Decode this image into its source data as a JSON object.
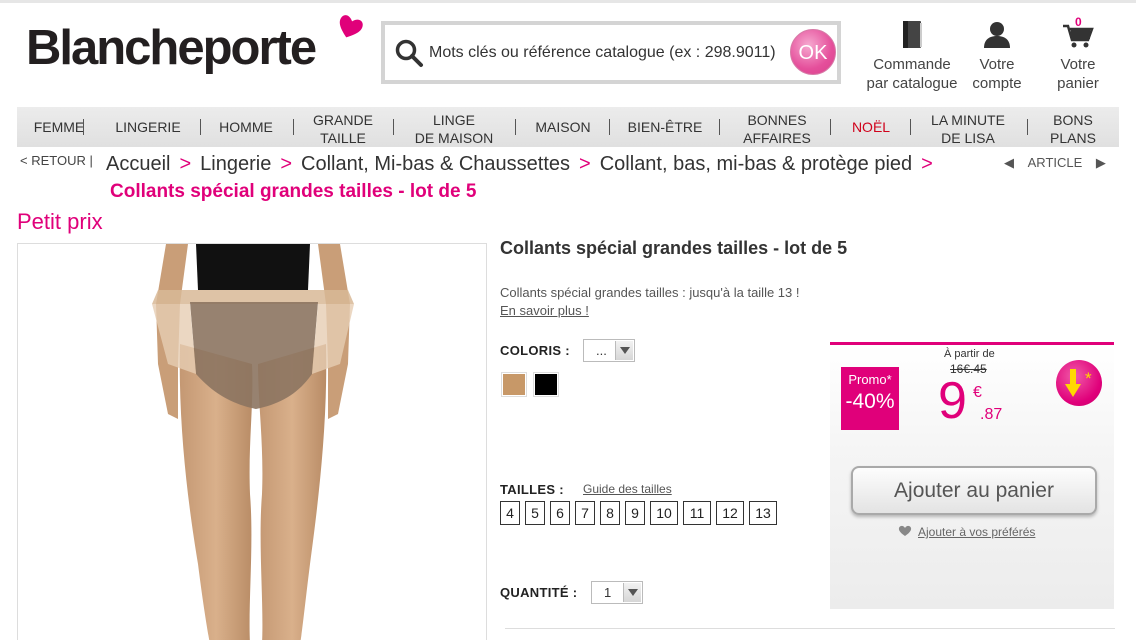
{
  "brand": {
    "logo_text": "Blancheporte"
  },
  "search": {
    "placeholder": "Mots clés ou référence catalogue (ex : 298.9011)",
    "button": "OK"
  },
  "header_links": {
    "catalogue": [
      "Commande",
      "par catalogue"
    ],
    "account": [
      "Votre",
      "compte"
    ],
    "cart": [
      "Votre",
      "panier"
    ],
    "cart_count": "0"
  },
  "nav": [
    [
      "FEMME"
    ],
    [
      "LINGERIE"
    ],
    [
      "HOMME"
    ],
    [
      "GRANDE",
      "TAILLE"
    ],
    [
      "LINGE",
      "DE MAISON"
    ],
    [
      "MAISON"
    ],
    [
      "BIEN-ÊTRE"
    ],
    [
      "BONNES",
      "AFFAIRES"
    ],
    [
      "NOËL"
    ],
    [
      "LA MINUTE",
      "DE LISA"
    ],
    [
      "BONS",
      "PLANS"
    ]
  ],
  "breadcrumb": {
    "back": "< RETOUR |",
    "items": [
      "Accueil",
      "Lingerie",
      "Collant, Mi-bas & Chaussettes",
      "Collant, bas, mi-bas & protège pied"
    ],
    "separator": ">",
    "current": "Collants spécial grandes tailles - lot de 5",
    "article": "ARTICLE"
  },
  "badge_label": "Petit prix",
  "product": {
    "title": "Collants spécial grandes tailles - lot de 5",
    "description": "Collants spécial grandes tailles : jusqu'à la taille 13 !",
    "more": "En savoir plus !",
    "colors_label": "COLORIS :",
    "colors_value": "...",
    "swatches": [
      "#c79868",
      "#000000"
    ],
    "sizes_label": "TAILLES :",
    "size_guide": "Guide des tailles",
    "sizes": [
      "4",
      "5",
      "6",
      "7",
      "8",
      "9",
      "10",
      "11",
      "12",
      "13"
    ],
    "qty_label": "QUANTITÉ :",
    "qty_value": "1"
  },
  "price": {
    "promo_label": "Promo*",
    "promo_pct": "-40%",
    "from": "À partir de",
    "old": "16€.45",
    "int": "9",
    "currency": "€",
    "dec": ".87",
    "add_to_cart": "Ajouter au panier",
    "favorites": "Ajouter à vos préférés"
  },
  "colors": {
    "accent": "#e0007a",
    "noel": "#d0021b"
  }
}
